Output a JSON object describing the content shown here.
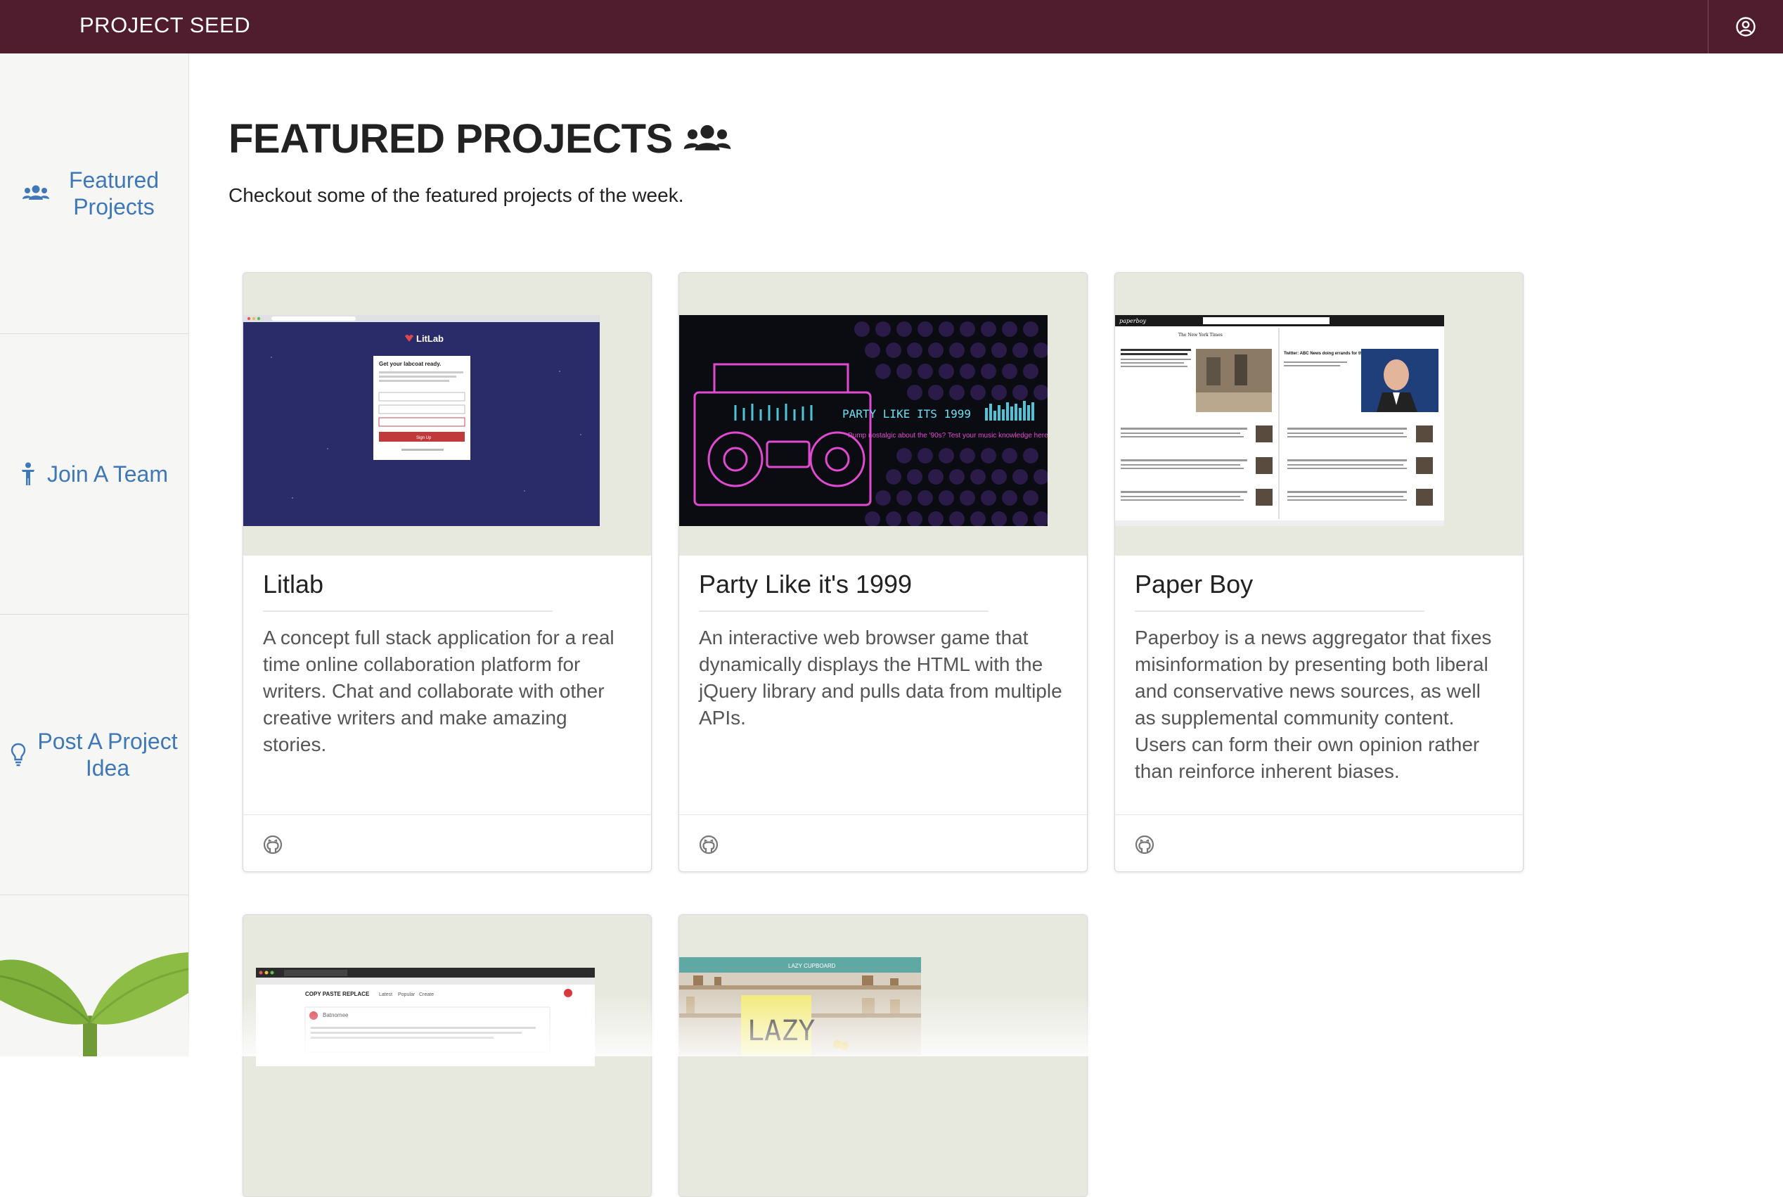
{
  "header": {
    "brand": "PROJECT SEED",
    "account_icon": "user-circle-icon"
  },
  "sidebar": {
    "items": [
      {
        "label": "Featured Projects",
        "icon": "users-icon"
      },
      {
        "label": "Join A Team",
        "icon": "person-icon"
      },
      {
        "label": "Post A Project Idea",
        "icon": "lightbulb-icon"
      }
    ]
  },
  "main": {
    "title": "FEATURED PROJECTS",
    "title_icon": "users-icon",
    "subtitle": "Checkout some of the featured projects of the week.",
    "cards": [
      {
        "title": "Litlab",
        "description": "A concept full stack application for a real time online collaboration platform for writers. Chat and collaborate with other creative writers and make amazing stories.",
        "screenshot": {
          "logo": "LitLab",
          "heading": "Get your labcoat ready.",
          "button": "Sign Up"
        },
        "link_icon": "github-icon"
      },
      {
        "title": "Party Like it's 1999",
        "description": "An interactive web browser game that dynamically displays the HTML with the jQuery library and pulls data from multiple APIs.",
        "screenshot": {
          "headline": "PARTY LIKE ITS 1999",
          "tagline": "Pump nostalgic about the '90s? Test your music knowledge here!"
        },
        "link_icon": "github-icon"
      },
      {
        "title": "Paper Boy",
        "description": "Paperboy is a news aggregator that fixes misinformation by presenting both liberal and conservative news sources, as well as supplemental community content. Users can form their own opinion rather than reinforce inherent biases.",
        "screenshot": {
          "logo": "paperboy",
          "left_source": "The New York Times",
          "right_headline": "Twitter: ABC News doing errands for the DNC"
        },
        "link_icon": "github-icon"
      },
      {
        "title": "",
        "description": "",
        "screenshot": {
          "heading": "COPY PASTE REPLACE",
          "tabs": [
            "Latest",
            "Popular",
            "Create"
          ],
          "post_title": "Batnomee"
        },
        "link_icon": "github-icon"
      },
      {
        "title": "",
        "description": "",
        "screenshot": {
          "header": "LAZY CUPBOARD",
          "sign": "LAZY"
        },
        "link_icon": "github-icon"
      }
    ]
  }
}
